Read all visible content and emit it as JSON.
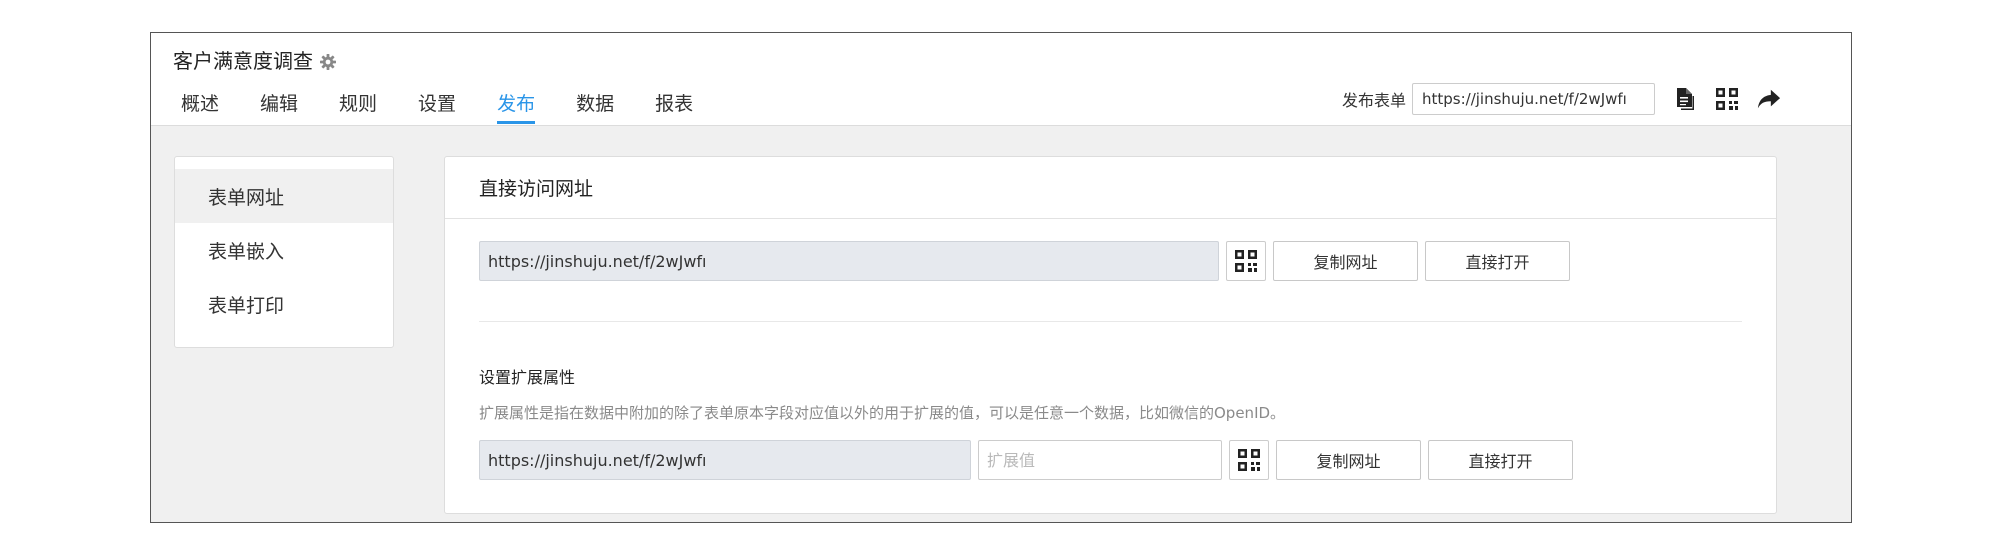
{
  "app": {
    "title": "客户满意度调查",
    "title_icon": "gear-icon"
  },
  "tabs": [
    {
      "label": "概述",
      "active": false
    },
    {
      "label": "编辑",
      "active": false
    },
    {
      "label": "规则",
      "active": false
    },
    {
      "label": "设置",
      "active": false
    },
    {
      "label": "发布",
      "active": true
    },
    {
      "label": "数据",
      "active": false
    },
    {
      "label": "报表",
      "active": false
    }
  ],
  "publish": {
    "label": "发布表单",
    "url": "https://jinshuju.net/f/2wJwfı",
    "icons": [
      "copy-document-icon",
      "qr-code-icon",
      "share-arrow-icon"
    ]
  },
  "sidebar": {
    "items": [
      {
        "label": "表单网址",
        "active": true
      },
      {
        "label": "表单嵌入",
        "active": false
      },
      {
        "label": "表单打印",
        "active": false
      }
    ]
  },
  "main": {
    "title": "直接访问网址",
    "direct": {
      "url": "https://jinshuju.net/f/2wJwfı",
      "copy_label": "复制网址",
      "open_label": "直接打开"
    },
    "extension": {
      "title": "设置扩展属性",
      "description": "扩展属性是指在数据中附加的除了表单原本字段对应值以外的用于扩展的值，可以是任意一个数据，比如微信的OpenID。",
      "url": "https://jinshuju.net/f/2wJwfı",
      "input_placeholder": "扩展值",
      "copy_label": "复制网址",
      "open_label": "直接打开"
    }
  },
  "colors": {
    "accent": "#2a95e8",
    "url_box_bg": "#e6e9ee",
    "page_bg": "#f0f0f0"
  }
}
